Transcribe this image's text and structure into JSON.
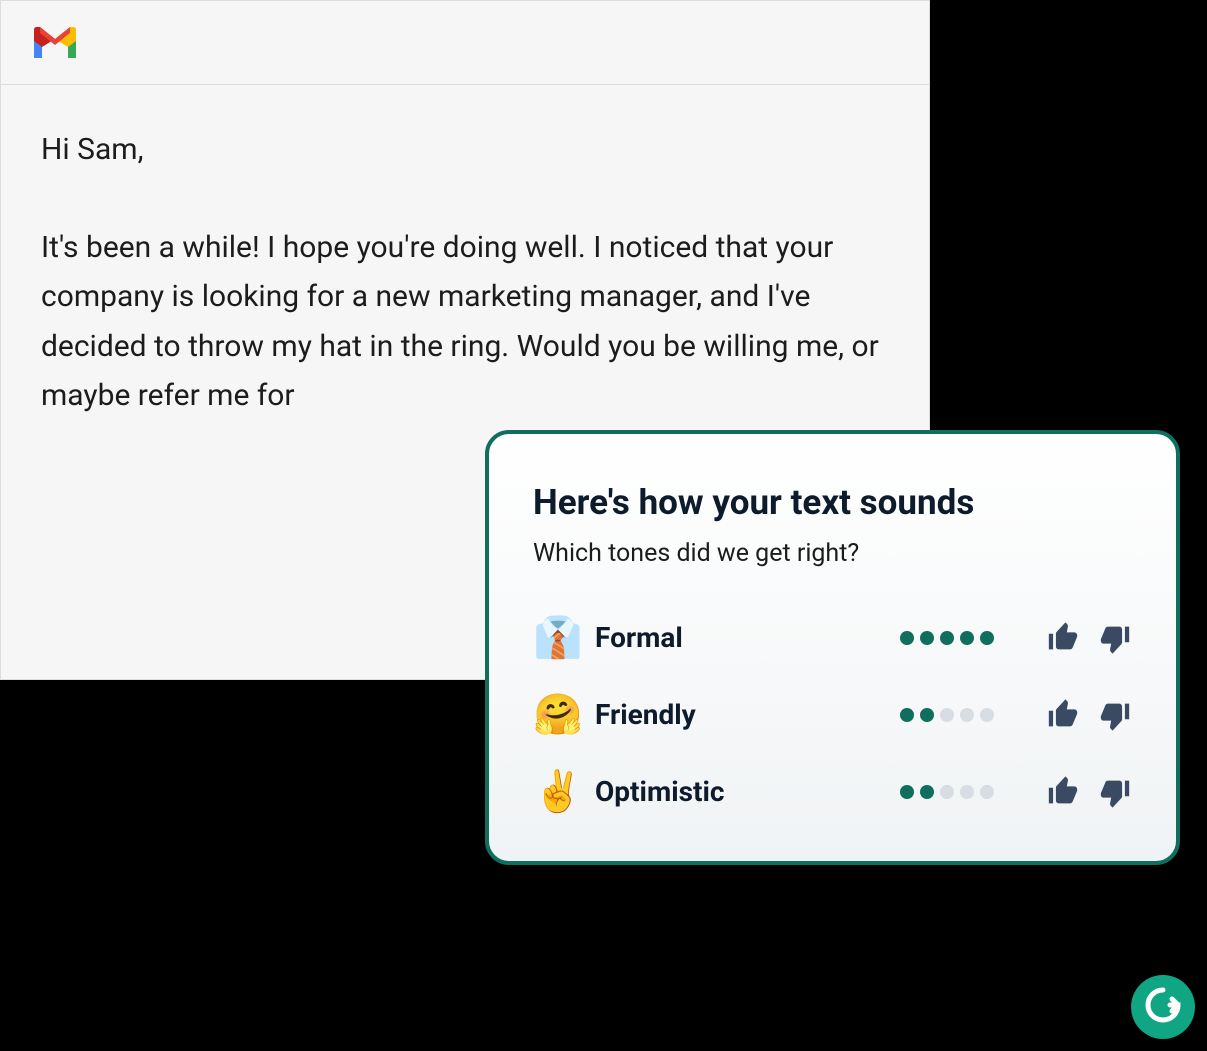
{
  "email": {
    "greeting": "Hi Sam,",
    "body": "It's been a while! I hope you're doing well. I noticed that your company is looking for a new marketing manager, and I've decided to throw my hat in the ring. Would you be willing me, or maybe refer me for"
  },
  "tone_panel": {
    "title": "Here's how your text sounds",
    "subtitle": "Which tones did we get right?",
    "tones": [
      {
        "emoji": "👔",
        "label": "Formal",
        "score": 5,
        "max": 5
      },
      {
        "emoji": "🤗",
        "label": "Friendly",
        "score": 2,
        "max": 5
      },
      {
        "emoji": "✌️",
        "label": "Optimistic",
        "score": 2,
        "max": 5
      }
    ]
  },
  "colors": {
    "brand_green": "#0f6e5c",
    "grammarly_green": "#11a683",
    "thumb_gray": "#3b4a63"
  }
}
